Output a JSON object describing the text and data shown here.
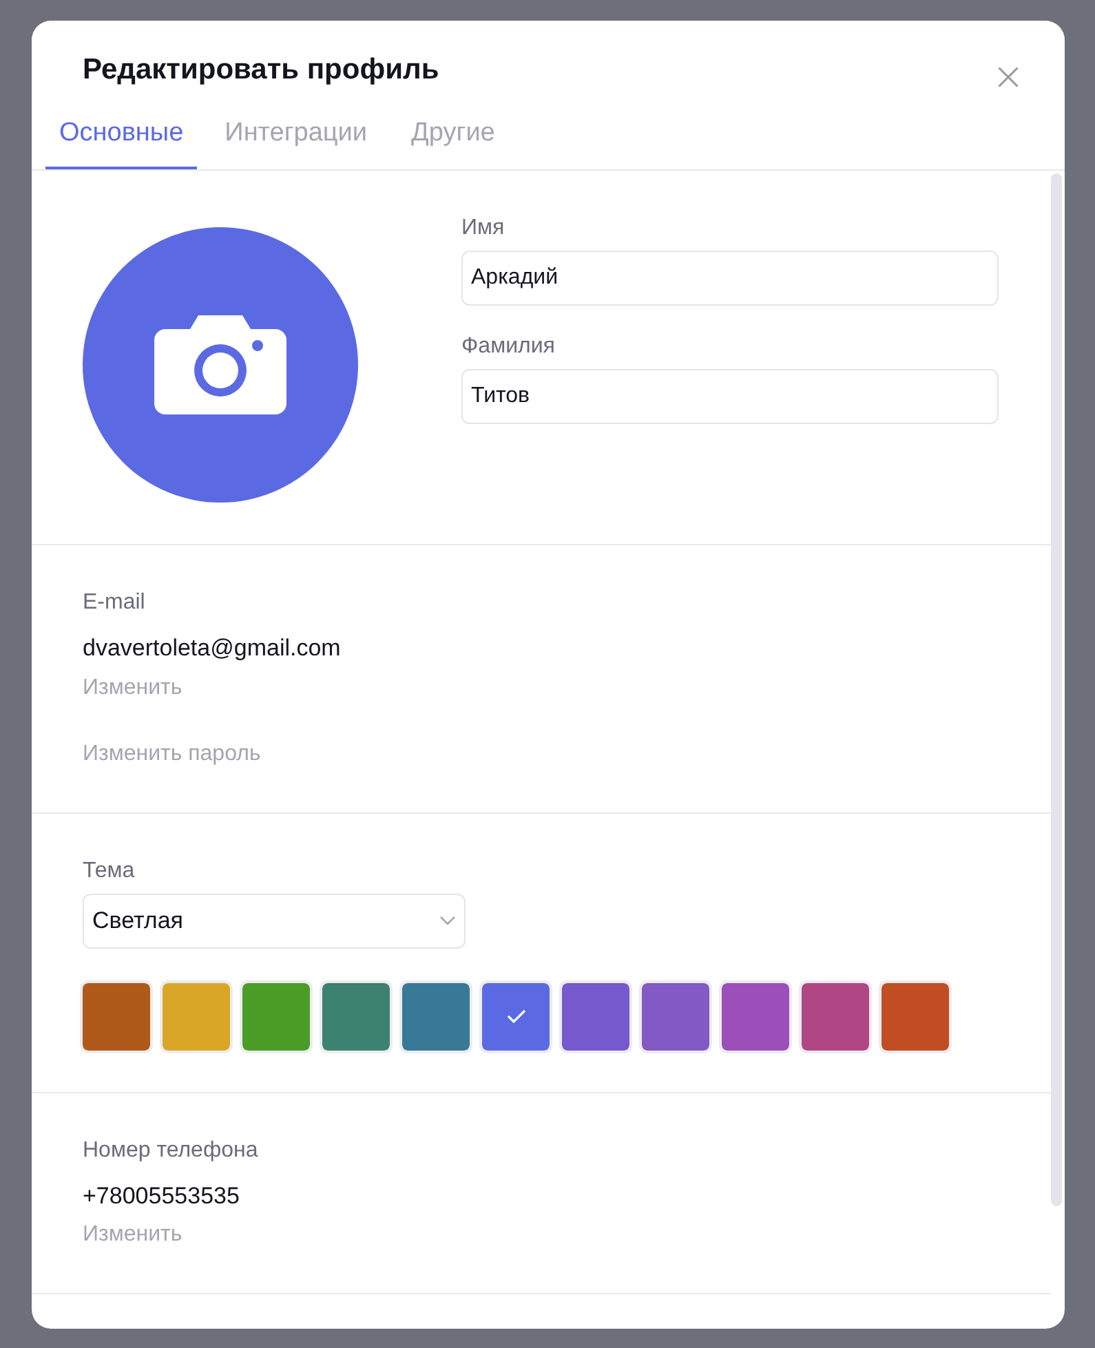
{
  "dialog": {
    "title": "Редактировать профиль"
  },
  "tabs": [
    {
      "label": "Основные",
      "selected": true
    },
    {
      "label": "Интеграции",
      "selected": false
    },
    {
      "label": "Другие",
      "selected": false
    }
  ],
  "profile": {
    "first_name": {
      "label": "Имя",
      "value": "Аркадий"
    },
    "last_name": {
      "label": "Фамилия",
      "value": "Титов"
    }
  },
  "email": {
    "label": "E-mail",
    "value": "dvavertoleta@gmail.com",
    "change_link": "Изменить",
    "password_link": "Изменить пароль"
  },
  "theme": {
    "label": "Тема",
    "value": "Светлая",
    "colors": [
      {
        "color": "#b05a1a",
        "selected": false
      },
      {
        "color": "#d9a628",
        "selected": false
      },
      {
        "color": "#4c9c28",
        "selected": false
      },
      {
        "color": "#3d8170",
        "selected": false
      },
      {
        "color": "#387996",
        "selected": false
      },
      {
        "color": "#5b6ae3",
        "selected": true
      },
      {
        "color": "#7659cc",
        "selected": false
      },
      {
        "color": "#8359c4",
        "selected": false
      },
      {
        "color": "#9c4fb8",
        "selected": false
      },
      {
        "color": "#b04784",
        "selected": false
      },
      {
        "color": "#c24d22",
        "selected": false
      }
    ]
  },
  "phone": {
    "label": "Номер телефона",
    "value": "+78005553535",
    "change_link": "Изменить"
  }
}
